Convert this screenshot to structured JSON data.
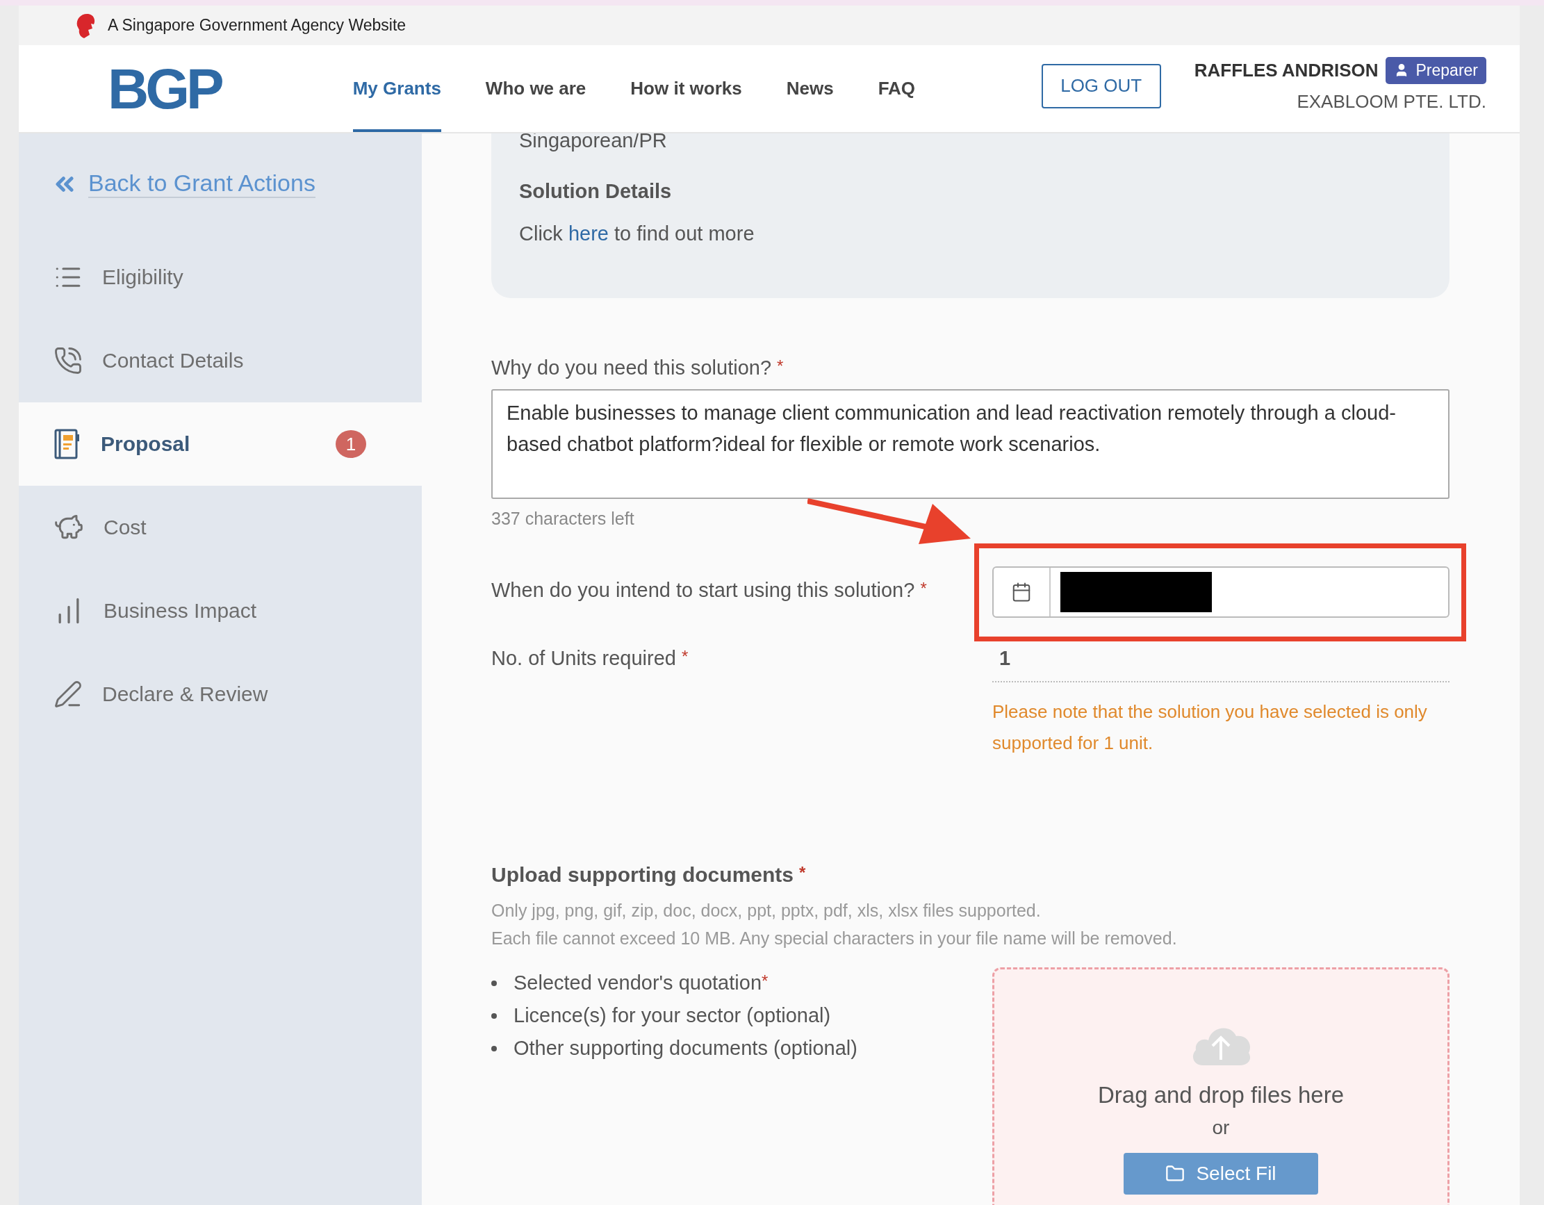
{
  "gov_banner": {
    "text": "A Singapore Government Agency Website"
  },
  "header": {
    "logo": "BGP",
    "nav": [
      {
        "label": "My Grants",
        "selected": true
      },
      {
        "label": "Who we are",
        "selected": false
      },
      {
        "label": "How it works",
        "selected": false
      },
      {
        "label": "News",
        "selected": false
      },
      {
        "label": "FAQ",
        "selected": false
      }
    ],
    "logout": "LOG OUT",
    "user": {
      "name": "RAFFLES ANDRISON",
      "role": "Preparer",
      "company": "EXABLOOM PTE. LTD."
    }
  },
  "sidebar": {
    "back_link": "Back to Grant Actions",
    "items": [
      {
        "label": "Eligibility",
        "selected": false
      },
      {
        "label": "Contact Details",
        "selected": false
      },
      {
        "label": "Proposal",
        "selected": true,
        "badge": "1"
      },
      {
        "label": "Cost",
        "selected": false
      },
      {
        "label": "Business Impact",
        "selected": false
      },
      {
        "label": "Declare & Review",
        "selected": false
      }
    ]
  },
  "summary_card": {
    "partial_text": "Singaporean/PR",
    "heading": "Solution Details",
    "sentence": {
      "before": "Click",
      "link": "here",
      "after": "to find out more"
    }
  },
  "form": {
    "reason": {
      "label": "Why do you need this solution?",
      "required_mark": "*",
      "value": "Enable businesses to manage client communication and lead reactivation remotely through a cloud-based chatbot platform?ideal for flexible or remote work scenarios.",
      "counter": "337 characters left"
    },
    "start_date": {
      "label": "When do you intend to start using this solution?",
      "required_mark": "*",
      "redacted": true,
      "highlighted": true
    },
    "units": {
      "label": "No. of Units required",
      "required_mark": "*",
      "value": "1",
      "note": "Please note that the solution you have selected is only supported for 1 unit."
    }
  },
  "upload": {
    "heading": "Upload supporting documents",
    "required_mark": "*",
    "hints": [
      "Only jpg, png, gif, zip, doc, docx, ppt, pptx, pdf, xls, xlsx files supported.",
      "Each file cannot exceed 10 MB. Any special characters in your file name will be removed."
    ],
    "documents": [
      {
        "label": "Selected vendor's quotation",
        "required_mark": "*"
      },
      {
        "label": "Licence(s) for your sector (optional)"
      },
      {
        "label": "Other supporting documents (optional)"
      }
    ],
    "dropzone": {
      "text": "Drag and drop files here",
      "or": "or",
      "button": "Select Fil"
    }
  }
}
